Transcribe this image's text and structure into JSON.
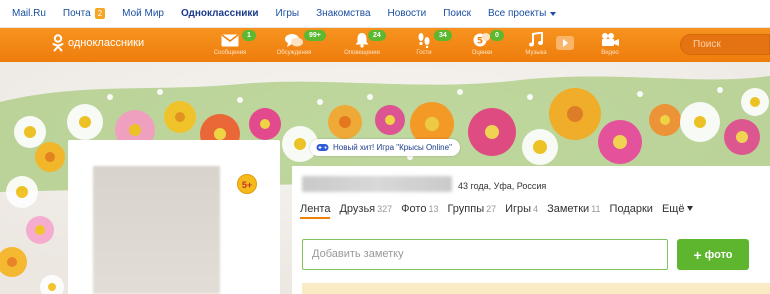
{
  "portal": {
    "links": [
      "Mail.Ru",
      "Почта",
      "Мой Мир",
      "Одноклассники",
      "Игры",
      "Знакомства",
      "Новости",
      "Поиск",
      "Все проекты"
    ],
    "mail_count": "2"
  },
  "nav": {
    "logo_text": "одноклассники",
    "items": [
      {
        "label": "Сообщения",
        "badge": "1",
        "icon": "envelope-icon"
      },
      {
        "label": "Обсуждения",
        "badge": "99+",
        "icon": "speech-bubbles-icon"
      },
      {
        "label": "Оповещения",
        "badge": "24",
        "icon": "bell-icon"
      },
      {
        "label": "Гости",
        "badge": "34",
        "icon": "footprints-icon"
      },
      {
        "label": "Оценки",
        "badge": "0",
        "icon": "rating-icon"
      },
      {
        "label": "Музыка",
        "badge": "",
        "icon": "music-note-icon"
      },
      {
        "label": "Видео",
        "badge": "",
        "icon": "video-camera-icon"
      }
    ],
    "search_placeholder": "Поиск"
  },
  "promo": {
    "text": "Новый хит! Игра \"Крысы Online\""
  },
  "profile": {
    "age_rating": "5+",
    "meta": "43 года, Уфа, Россия"
  },
  "tabs": [
    {
      "label": "Лента",
      "count": ""
    },
    {
      "label": "Друзья",
      "count": "327"
    },
    {
      "label": "Фото",
      "count": "13"
    },
    {
      "label": "Группы",
      "count": "27"
    },
    {
      "label": "Игры",
      "count": "4"
    },
    {
      "label": "Заметки",
      "count": "11"
    },
    {
      "label": "Подарки",
      "count": ""
    },
    {
      "label": "Ещё",
      "count": ""
    }
  ],
  "note": {
    "placeholder": "Добавить заметку"
  },
  "photo_button": {
    "label": "фото"
  },
  "colors": {
    "accent": "#ee8208",
    "green": "#5db62e",
    "link": "#1a4fa0"
  }
}
